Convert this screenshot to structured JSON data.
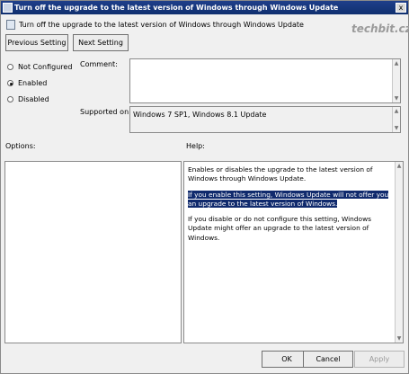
{
  "window": {
    "title": "Turn off the upgrade to the latest version of Windows through Windows Update",
    "close_glyph": "x",
    "header": "Turn off the upgrade to the latest version of Windows through Windows Update",
    "watermark": "techbit.cz"
  },
  "nav": {
    "previous_label": "Previous Setting",
    "next_label": "Next Setting"
  },
  "state": {
    "options": [
      {
        "label": "Not Configured",
        "selected": false
      },
      {
        "label": "Enabled",
        "selected": true
      },
      {
        "label": "Disabled",
        "selected": false
      }
    ]
  },
  "comment": {
    "label": "Comment:",
    "value": ""
  },
  "supported": {
    "label": "Supported on:",
    "value": "Windows 7 SP1, Windows 8.1 Update"
  },
  "options_panel": {
    "label": "Options:"
  },
  "help_panel": {
    "label": "Help:",
    "para1": "Enables or disables the upgrade to the latest version of Windows through Windows Update.",
    "para2": "If you enable this setting, Windows Update will not offer you an upgrade to the latest version of Windows.",
    "para3": "If you disable or do not configure this setting, Windows Update might offer an upgrade to the latest version of Windows."
  },
  "buttons": {
    "ok": "OK",
    "cancel": "Cancel",
    "apply": "Apply"
  }
}
